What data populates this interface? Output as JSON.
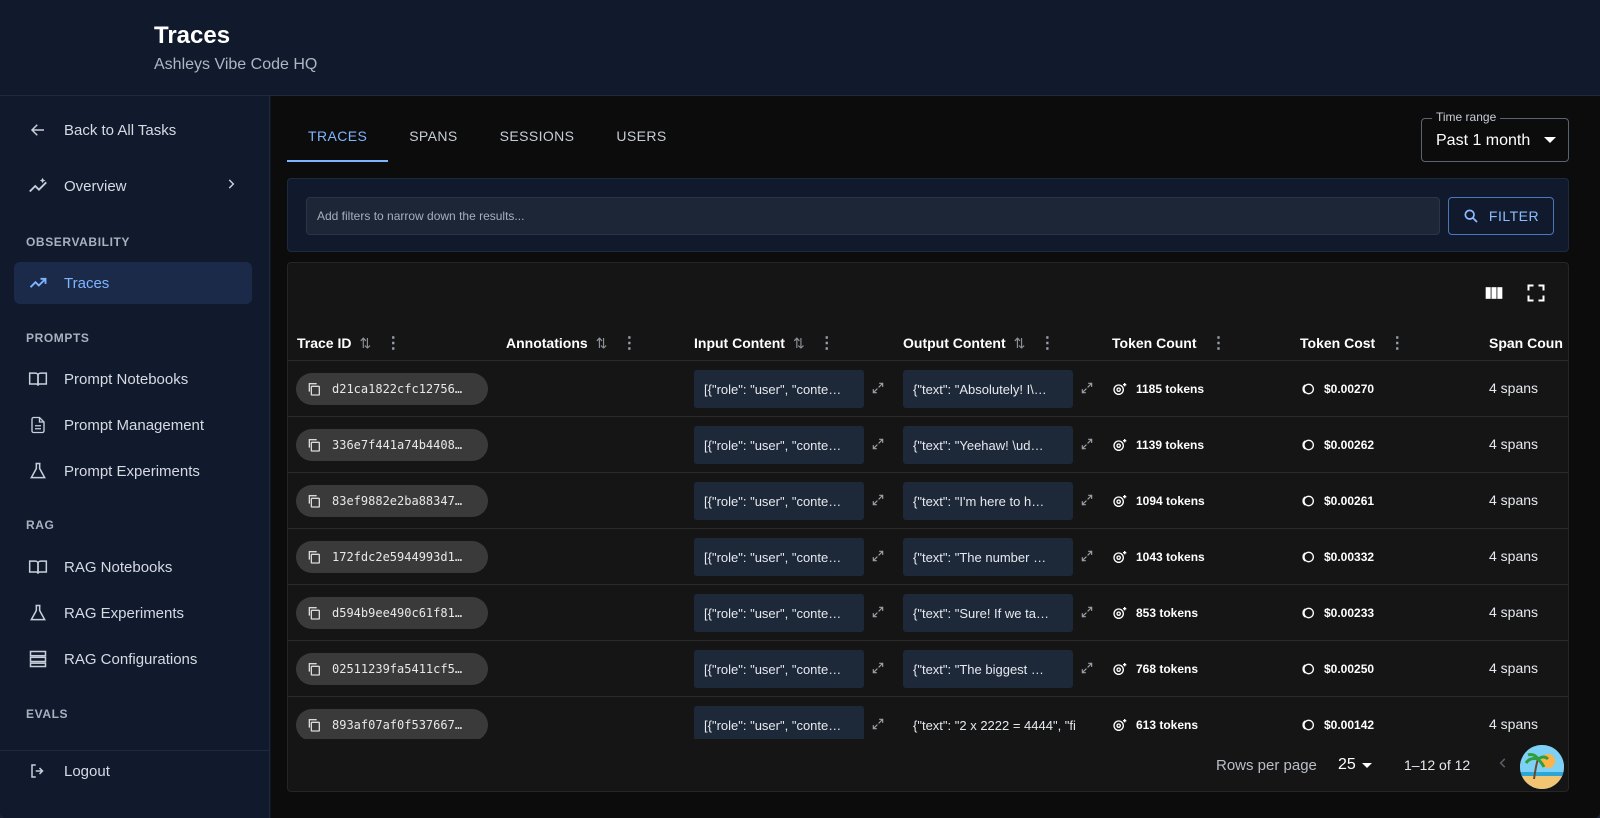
{
  "header": {
    "title": "Traces",
    "subtitle": "Ashleys Vibe Code HQ"
  },
  "sidebar": {
    "back_label": "Back to All Tasks",
    "overview_label": "Overview",
    "sections": {
      "observability": "OBSERVABILITY",
      "prompts": "PROMPTS",
      "rag": "RAG",
      "evals": "EVALS"
    },
    "items": {
      "traces": "Traces",
      "prompt_notebooks": "Prompt Notebooks",
      "prompt_management": "Prompt Management",
      "prompt_experiments": "Prompt Experiments",
      "rag_notebooks": "RAG Notebooks",
      "rag_experiments": "RAG Experiments",
      "rag_configurations": "RAG Configurations"
    },
    "logout_label": "Logout"
  },
  "tabs": [
    "TRACES",
    "SPANS",
    "SESSIONS",
    "USERS"
  ],
  "time_range": {
    "label": "Time range",
    "value": "Past 1 month"
  },
  "filter": {
    "placeholder": "Add filters to narrow down the results...",
    "button_label": "FILTER"
  },
  "table": {
    "columns": {
      "trace_id": "Trace ID",
      "annotations": "Annotations",
      "input": "Input Content",
      "output": "Output Content",
      "token_count": "Token Count",
      "token_cost": "Token Cost",
      "span_count": "Span Coun"
    },
    "rows": [
      {
        "trace_id": "d21ca1822cfc12756…",
        "input": "[{\"role\": \"user\", \"conte…",
        "output": "{\"text\": \"Absolutely! I\\…",
        "tokens": "1185 tokens",
        "cost": "$0.00270",
        "spans": "4 spans"
      },
      {
        "trace_id": "336e7f441a74b4408…",
        "input": "[{\"role\": \"user\", \"conte…",
        "output": "{\"text\": \"Yeehaw! \\ud…",
        "tokens": "1139 tokens",
        "cost": "$0.00262",
        "spans": "4 spans"
      },
      {
        "trace_id": "83ef9882e2ba88347…",
        "input": "[{\"role\": \"user\", \"conte…",
        "output": "{\"text\": \"I'm here to h…",
        "tokens": "1094 tokens",
        "cost": "$0.00261",
        "spans": "4 spans"
      },
      {
        "trace_id": "172fdc2e5944993d1…",
        "input": "[{\"role\": \"user\", \"conte…",
        "output": "{\"text\": \"The number …",
        "tokens": "1043 tokens",
        "cost": "$0.00332",
        "spans": "4 spans"
      },
      {
        "trace_id": "d594b9ee490c61f81…",
        "input": "[{\"role\": \"user\", \"conte…",
        "output": "{\"text\": \"Sure! If we ta…",
        "tokens": "853 tokens",
        "cost": "$0.00233",
        "spans": "4 spans"
      },
      {
        "trace_id": "02511239fa5411cf5…",
        "input": "[{\"role\": \"user\", \"conte…",
        "output": "{\"text\": \"The biggest …",
        "tokens": "768 tokens",
        "cost": "$0.00250",
        "spans": "4 spans"
      },
      {
        "trace_id": "893af07af0f537667…",
        "input": "[{\"role\": \"user\", \"conte…",
        "output": "{\"text\": \"2 x 2222 = 4444\", \"fi",
        "tokens": "613 tokens",
        "cost": "$0.00142",
        "spans": "4 spans"
      }
    ]
  },
  "pagination": {
    "rows_per_page_label": "Rows per page",
    "rows_per_page_value": "25",
    "range_text": "1–12 of 12"
  },
  "colors": {
    "accent": "#7fb4ff",
    "sidebar_bg": "#111a2c",
    "main_bg": "#0c0c0c",
    "table_bg": "#151515"
  }
}
